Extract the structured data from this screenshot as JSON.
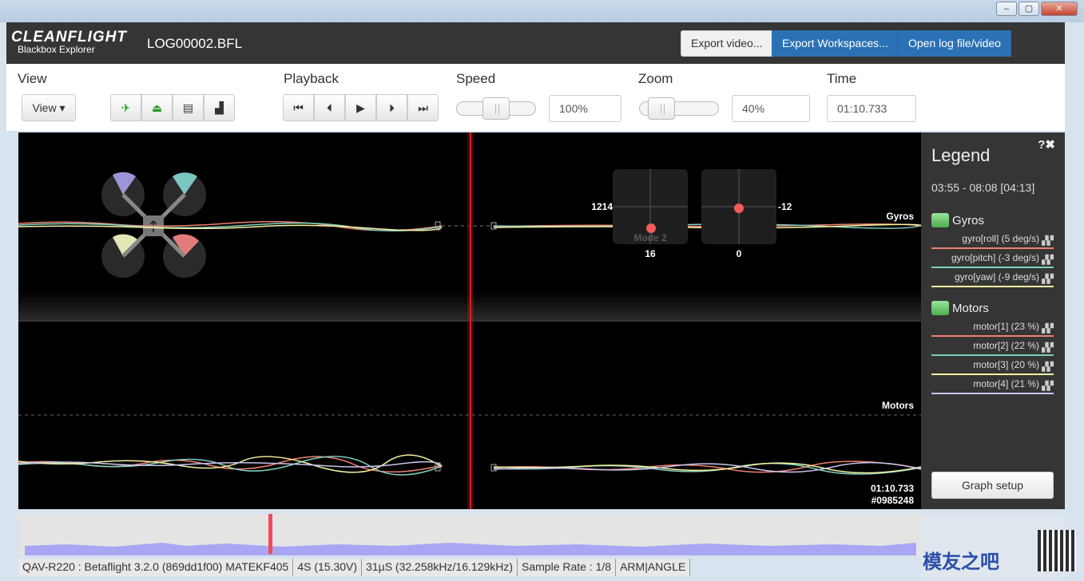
{
  "app": {
    "logo": "CLEANFLIGHT",
    "logo_sub": "Blackbox Explorer",
    "filename": "LOG00002.BFL",
    "export_video": "Export video...",
    "export_workspaces": "Export Workspaces...",
    "open_log": "Open log file/video"
  },
  "toolbar": {
    "view_label": "View",
    "view_dropdown": "View ▾",
    "playback_label": "Playback",
    "speed_label": "Speed",
    "speed_value": "100%",
    "speed_level": 0.5,
    "zoom_label": "Zoom",
    "zoom_value": "40%",
    "zoom_level": 0.15,
    "time_label": "Time",
    "time_value": "01:10.733"
  },
  "graph": {
    "gyros_label": "Gyros",
    "motors_label": "Motors",
    "stick_left_x": "1214",
    "stick_left_y": "16",
    "stick_right_x": "-12",
    "stick_right_y": "0",
    "mode": "Mode 2",
    "cursor_time": "01:10.733",
    "cursor_frame": "#0985248"
  },
  "legend": {
    "title": "Legend",
    "range": "03:55 - 08:08 [04:13]",
    "help_icon": "?✖",
    "groups": [
      {
        "name": "Gyros",
        "items": [
          {
            "label": "gyro[roll] (5 deg/s)",
            "color": "#f08070"
          },
          {
            "label": "gyro[pitch] (-3 deg/s)",
            "color": "#7fcfc0"
          },
          {
            "label": "gyro[yaw] (-9 deg/s)",
            "color": "#f6f3a0"
          }
        ]
      },
      {
        "name": "Motors",
        "items": [
          {
            "label": "motor[1] (23 %)",
            "color": "#f08070"
          },
          {
            "label": "motor[2] (22 %)",
            "color": "#7fcfc0"
          },
          {
            "label": "motor[3] (20 %)",
            "color": "#f6f3a0"
          },
          {
            "label": "motor[4] (21 %)",
            "color": "#c8c4ee"
          }
        ]
      }
    ],
    "graph_setup": "Graph setup"
  },
  "status": [
    "QAV-R220 : Betaflight 3.2.0 (869dd1f00) MATEKF405",
    "4S (15.30V)",
    "31µS (32.258kHz/16.129kHz)",
    "Sample Rate : 1/8",
    "ARM|ANGLE"
  ],
  "watermark": "模友之吧"
}
